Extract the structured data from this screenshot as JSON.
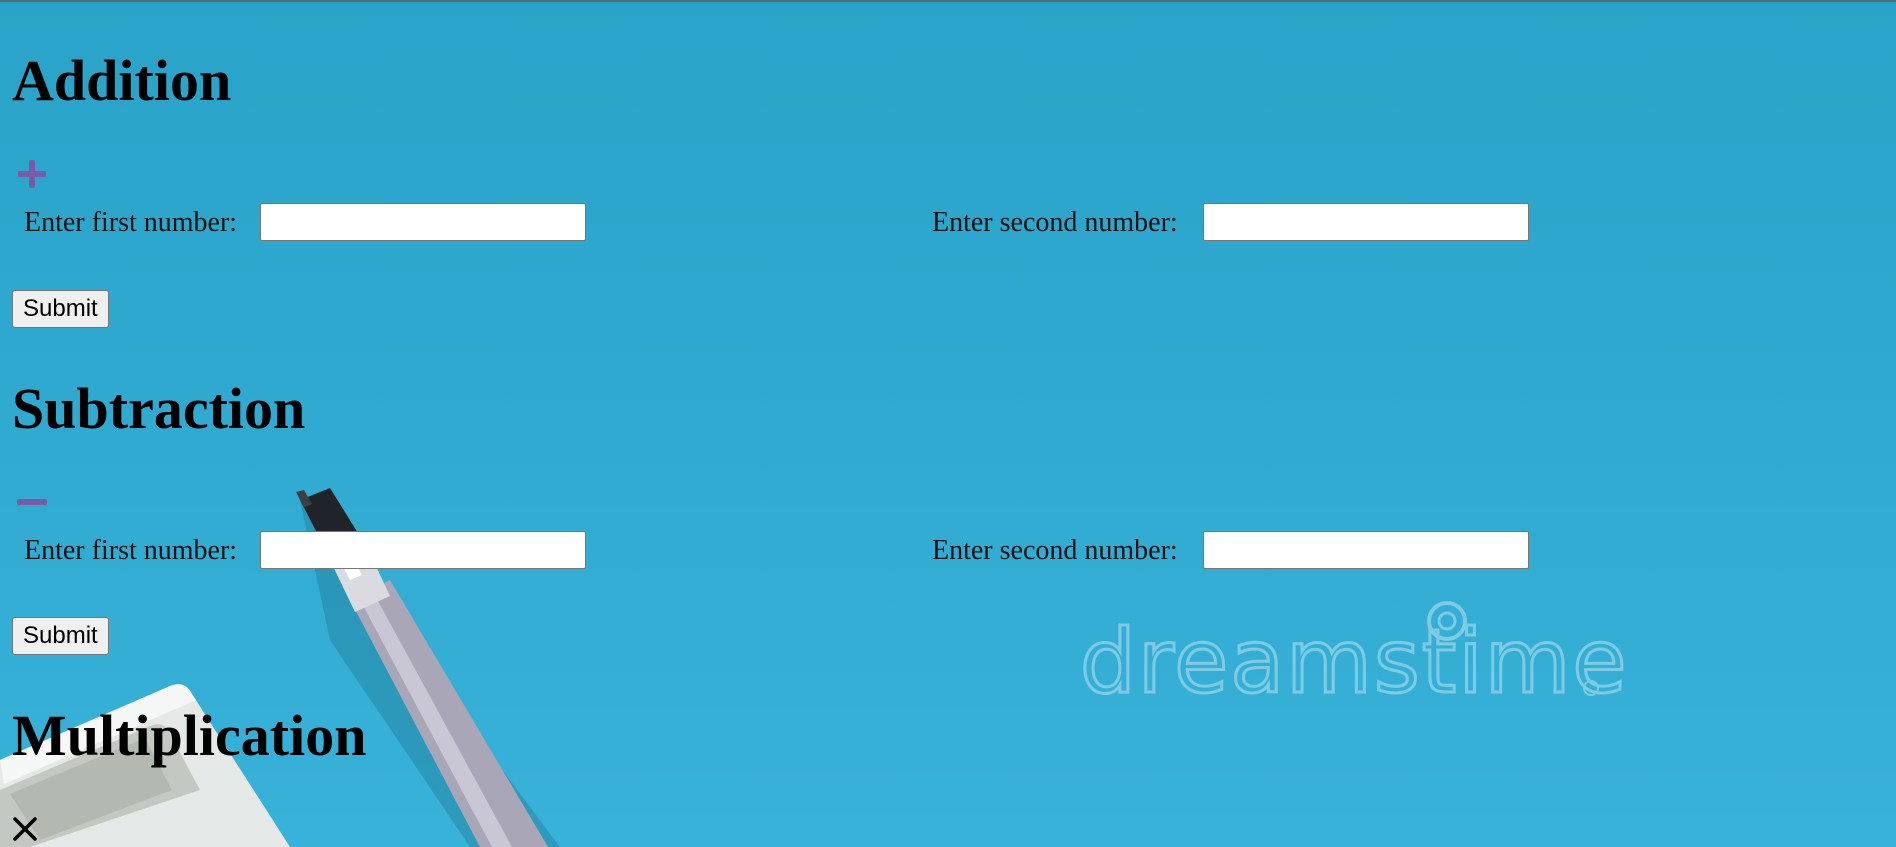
{
  "sections": {
    "addition": {
      "title": "Addition",
      "icon": "plus-icon",
      "first_label": "Enter first number:",
      "first_value": "",
      "second_label": "Enter second number:",
      "second_value": "",
      "submit_label": "Submit"
    },
    "subtraction": {
      "title": "Subtraction",
      "icon": "minus-icon",
      "first_label": "Enter first number:",
      "first_value": "",
      "second_label": "Enter second number:",
      "second_value": "",
      "submit_label": "Submit"
    },
    "multiplication": {
      "title": "Multiplication",
      "icon": "times-icon"
    }
  },
  "colors": {
    "background": "#2fa9cf",
    "icon_accent": "#7b5aa6",
    "text": "#000000"
  }
}
